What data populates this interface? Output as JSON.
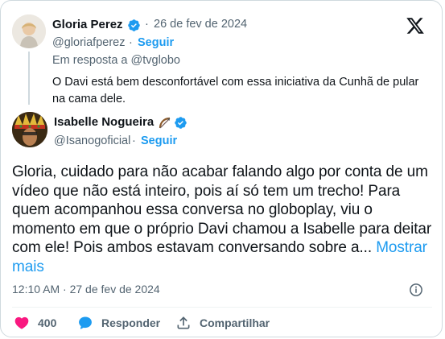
{
  "reply": {
    "author_name": "Gloria Perez",
    "dot": "·",
    "date": "26 de fev de 2024",
    "handle": "@gloriafperez",
    "sep": "·",
    "follow_label": "Seguir",
    "in_reply_to": "Em resposta a @tvglobo",
    "text": "O Davi está bem desconfortável com essa iniciativa da Cunhã de pular na cama dele."
  },
  "main": {
    "author_name": "Isabelle Nogueira",
    "handle": "@Isanogoficial",
    "sep": "·",
    "follow_label": "Seguir",
    "text": "Gloria, cuidado para não acabar falando algo por conta de um vídeo que não está inteiro, pois aí só tem um trecho! Para quem acompanhou essa conversa no globoplay, viu o momento em que o próprio Davi chamou a Isabelle para deitar com ele! Pois ambos estavam conversando sobre a...",
    "show_more": "Mostrar mais",
    "timestamp": "12:10 AM · 27 de fev de 2024"
  },
  "actions": {
    "like_count": "400",
    "reply_label": "Responder",
    "share_label": "Compartilhar"
  },
  "colors": {
    "accent": "#1d9bf0",
    "like": "#f91880",
    "text": "#0f1419",
    "muted": "#536471"
  },
  "icons": {
    "platform": "x-logo-icon",
    "verified": "verified-badge-icon",
    "bow": "bow-arrow-emoji-icon",
    "info": "info-icon",
    "like": "heart-icon",
    "reply": "speech-bubble-icon",
    "share": "share-icon"
  }
}
